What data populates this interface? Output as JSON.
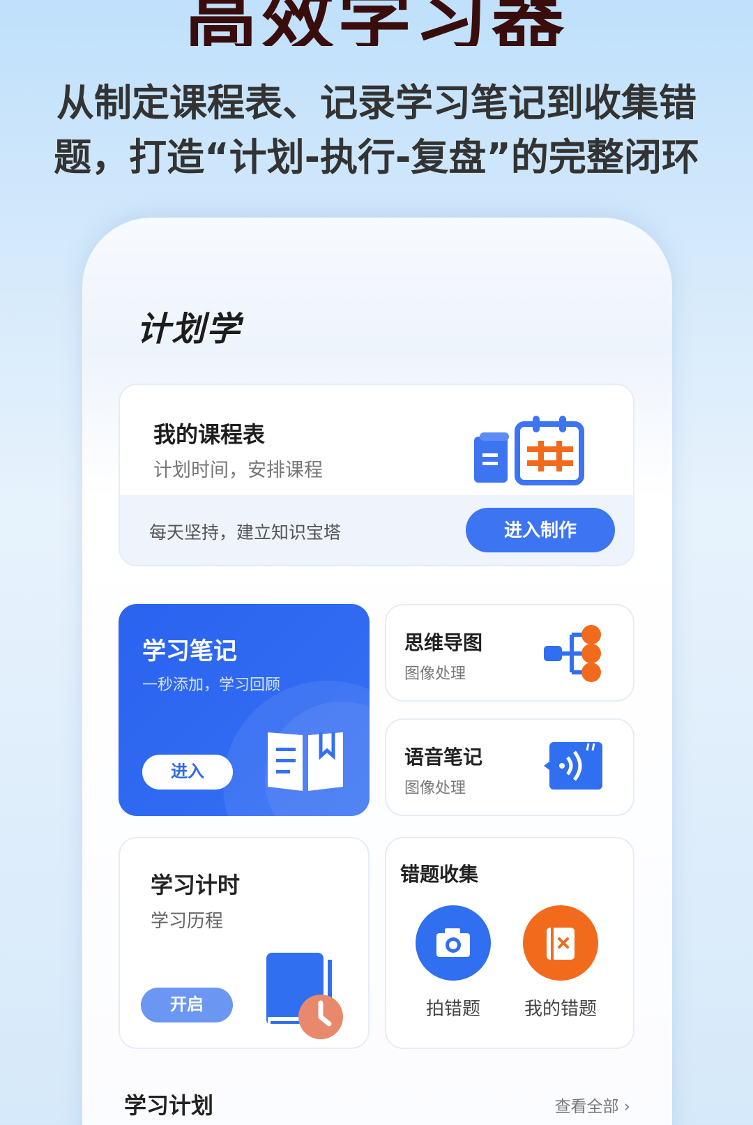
{
  "hero": {
    "title": "高效学习器",
    "subtitle_line1": "从制定课程表、记录学习笔记到收集错",
    "subtitle_line2": "题，打造“计划-执行-复盘”的完整闭环"
  },
  "section": {
    "title": "计划学"
  },
  "timetable": {
    "title": "我的课程表",
    "subtitle": "计划时间，安排课程",
    "footer_text": "每天坚持，建立知识宝塔",
    "button": "进入制作",
    "icon": "calendar-icon"
  },
  "notes": {
    "title": "学习笔记",
    "subtitle": "一秒添加，学习回顾",
    "button": "进入",
    "icon": "open-book-icon"
  },
  "mindmap": {
    "title": "思维导图",
    "subtitle": "图像处理",
    "icon": "mindmap-icon"
  },
  "voice": {
    "title": "语音笔记",
    "subtitle": "图像处理",
    "icon": "voice-note-icon"
  },
  "timer": {
    "title": "学习计时",
    "subtitle": "学习历程",
    "button": "开启",
    "icon": "book-clock-icon"
  },
  "wrong": {
    "title": "错题收集",
    "items": [
      {
        "label": "拍错题",
        "icon": "camera-icon",
        "color": "#2f6ff0"
      },
      {
        "label": "我的错题",
        "icon": "wrong-book-icon",
        "color": "#f26a1b"
      }
    ]
  },
  "plan": {
    "title": "学习计划",
    "view_all": "查看全部 ›"
  },
  "colors": {
    "primary": "#3d74f2",
    "accent_orange": "#f26a1b",
    "hero_title": "#3a0d0d"
  }
}
